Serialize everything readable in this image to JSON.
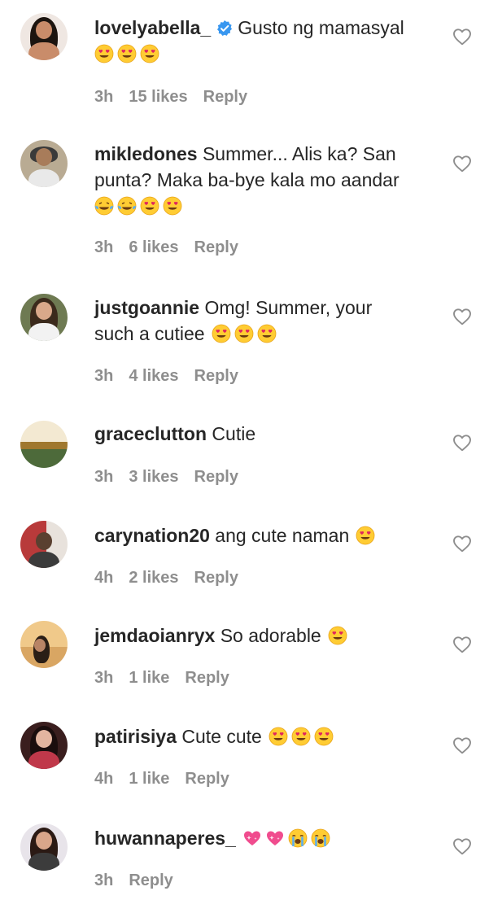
{
  "comments": [
    {
      "username": "lovelyabella_",
      "verified": true,
      "text": "Gusto ng mamasyal",
      "emojis": [
        "heart-eyes",
        "heart-eyes",
        "heart-eyes"
      ],
      "time": "3h",
      "likes": "15 likes",
      "reply": "Reply"
    },
    {
      "username": "mikledones",
      "text_line1": "Summer... Alis ka? San",
      "text_line2": "punta? Maka ba-bye kala mo aandar",
      "emojis": [
        "tears-of-joy",
        "tears-of-joy",
        "heart-eyes",
        "heart-eyes"
      ],
      "time": "3h",
      "likes": "6 likes",
      "reply": "Reply"
    },
    {
      "username": "justgoannie",
      "text_line1": "Omg! Summer, your",
      "text_line2": "such a cutiee",
      "emojis": [
        "heart-eyes",
        "heart-eyes",
        "heart-eyes"
      ],
      "time": "3h",
      "likes": "4 likes",
      "reply": "Reply"
    },
    {
      "username": "graceclutton",
      "text": "Cutie",
      "time": "3h",
      "likes": "3 likes",
      "reply": "Reply"
    },
    {
      "username": "carynation20",
      "text": "ang cute naman",
      "emojis": [
        "heart-eyes"
      ],
      "time": "4h",
      "likes": "2 likes",
      "reply": "Reply"
    },
    {
      "username": "jemdaoianryx",
      "text": "So adorable",
      "emojis": [
        "heart-eyes"
      ],
      "time": "3h",
      "likes": "1 like",
      "reply": "Reply"
    },
    {
      "username": "patirisiya",
      "text": "Cute cute",
      "emojis": [
        "heart-eyes",
        "heart-eyes",
        "heart-eyes"
      ],
      "time": "4h",
      "likes": "1 like",
      "reply": "Reply"
    },
    {
      "username": "huwannaperes_",
      "text": "",
      "emojis": [
        "sparkling-heart",
        "sparkling-heart",
        "loudly-crying",
        "loudly-crying"
      ],
      "time": "3h",
      "reply": "Reply"
    }
  ],
  "icons": {
    "like": "heart-outline-icon",
    "verified": "verified-badge-icon"
  },
  "colors": {
    "text": "#262626",
    "meta": "#8e8e8e",
    "verified": "#3897f0",
    "heart_icon": "#8e8e8e"
  }
}
